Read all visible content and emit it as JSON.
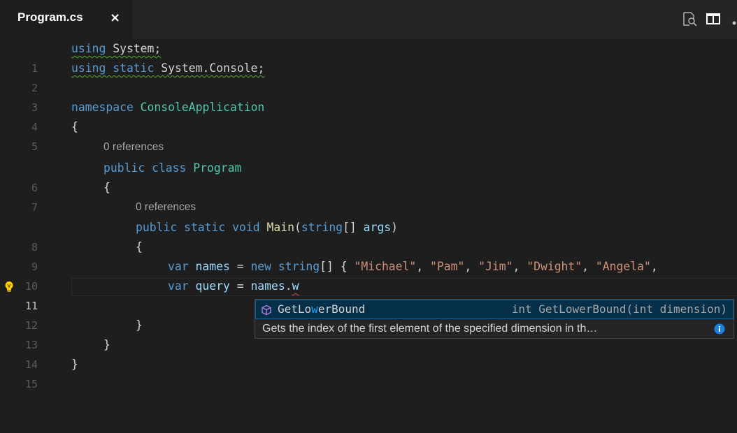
{
  "tab": {
    "title": "Program.cs",
    "close_glyph": "×"
  },
  "toolbar": {
    "icons": [
      "find-references-icon",
      "split-editor-icon",
      "more-actions-icon"
    ]
  },
  "lines": [
    {
      "n": "1",
      "t1": "using",
      "t2": " System;"
    },
    {
      "n": "2",
      "t1": "using static",
      "t2": " System.Console;"
    },
    {
      "n": "3"
    },
    {
      "n": "4",
      "t1": "namespace",
      "t2": " ConsoleApplication"
    },
    {
      "n": "5",
      "t1": "{"
    },
    {
      "n": "6",
      "t1": "public class",
      "t2": " Program"
    },
    {
      "n": "7",
      "t1": "{"
    },
    {
      "n": "8",
      "t1": "public static void",
      "t2": " Main",
      "t3": "(",
      "t4": "string",
      "t5": "[] ",
      "t6": "args",
      "t7": ")"
    },
    {
      "n": "9",
      "t1": "{"
    },
    {
      "n": "10",
      "t1": "var",
      "t2": " names",
      "t3": " = ",
      "t4": "new",
      "t5": " string",
      "t6": "[] { ",
      "s1": "\"Michael\"",
      "s2": "\"Pam\"",
      "s3": "\"Jim\"",
      "s4": "\"Dwight\"",
      "s5": "\"Angela\"",
      "sep": ", "
    },
    {
      "n": "11",
      "t1": "var",
      "t2": " query",
      "t3": " = ",
      "t4": "names",
      "t5": ".",
      "t6": "w"
    },
    {
      "n": "12"
    },
    {
      "n": "13",
      "t1": "}"
    },
    {
      "n": "14",
      "t1": "}"
    },
    {
      "n": "15",
      "t1": "}"
    }
  ],
  "codelens": [
    "0 references",
    "0 references"
  ],
  "suggest": {
    "label_pre": "GetLo",
    "label_hl": "w",
    "label_post": "erBound",
    "signature": "int GetLowerBound(int dimension)",
    "doc": "Gets the index of the first element of the specified dimension in th…",
    "icon": "method-cube-icon",
    "info_icon": "info-icon"
  },
  "colors": {
    "background": "#1e1e1e",
    "keyword": "#569cd6",
    "type": "#4ec9b0",
    "string": "#ce9178",
    "function": "#dcdcaa",
    "variable": "#9cdcfe",
    "accent": "#0e639c"
  }
}
